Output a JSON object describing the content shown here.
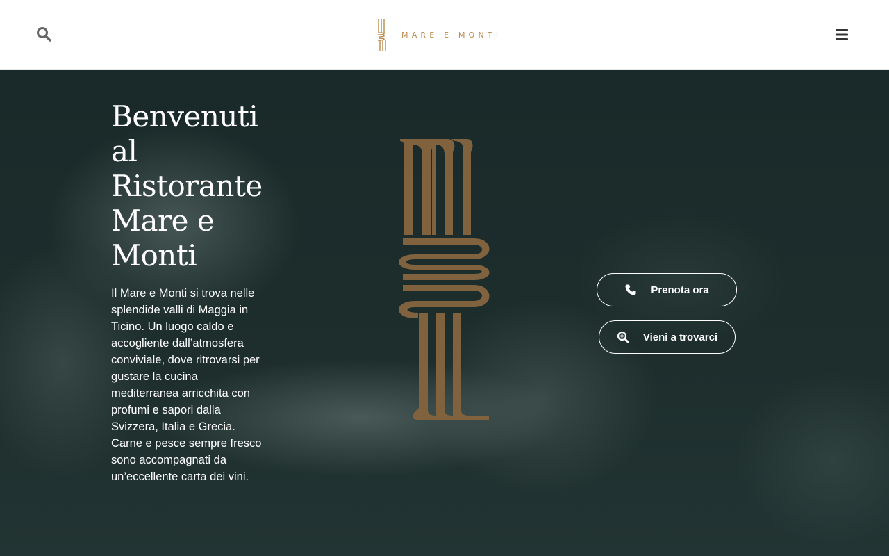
{
  "header": {
    "brand": "MARE E MONTI",
    "search_icon": "search-icon",
    "menu_icon": "hamburger-menu-icon"
  },
  "hero": {
    "title": "Benvenuti al Ristorante Mare e Monti",
    "description": "Il Mare e Monti si trova nelle splendide valli di Maggia in Ticino. Un luogo caldo e accogliente dall’atmosfera conviviale, dove ritrovarsi per gustare la cucina mediterranea arricchita con profumi e sapori dalla Svizzera, Italia e Grecia. Carne e pesce sempre fresco sono accompagnati da un’eccellente carta dei vini.",
    "buttons": {
      "reserve_label": "Prenota ora",
      "visit_label": "Vieni a trovarci"
    }
  },
  "colors": {
    "gold": "#b88a4e",
    "logo_brown": "#80623f",
    "hero_bg": "#1d2e2d"
  }
}
